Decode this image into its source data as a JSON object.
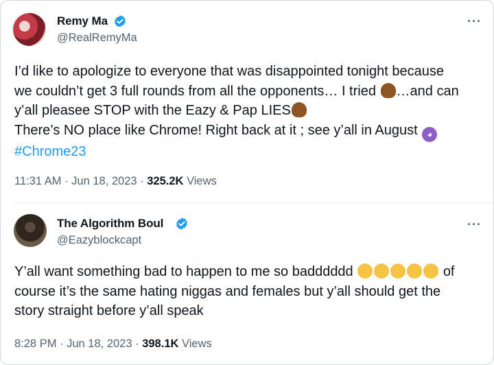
{
  "tweets": [
    {
      "author": {
        "name": "Remy Ma",
        "handle": "@RealRemyMa",
        "verified": true
      },
      "text": {
        "line1": "I’d like to apologize to everyone that was disappointed tonight because",
        "line2": "we couldn’t get 3 full rounds from all the opponents… I tried",
        "line2b": "…and can",
        "line3": "y’all pleasee STOP with the Eazy & Pap LIES",
        "line4": "There’s NO place like Chrome! Right back at it ; see y’all in August",
        "hashtag": "#Chrome23"
      },
      "timestamp": "11:31 AM · Jun 18, 2023 ·",
      "views_count": "325.2K",
      "views_label": "Views",
      "more_label": "···"
    },
    {
      "author": {
        "name": "The Algorithm Boul",
        "handle": "@Eazyblockcapt",
        "verified": true
      },
      "text": {
        "line1a": "Y’all want something bad to happen to me so badddddd",
        "line1b": "of",
        "line2": "course it’s the same hating niggas and females but y’all should get the",
        "line3": "story straight before y’all speak"
      },
      "timestamp": "8:28 PM · Jun 18, 2023 ·",
      "views_count": "398.1K",
      "views_label": "Views",
      "more_label": "···"
    }
  ],
  "colors": {
    "verified": "#1d9bf0",
    "hashtag": "#1d9bf0",
    "secondary_text": "#536471",
    "border": "#cfd9de"
  },
  "icons": [
    "verified-badge-icon",
    "more-options-icon",
    "person-facepalm-emoji",
    "person-gesturing-no-emoji",
    "smiling-face-with-horns-emoji",
    "face-with-tears-of-joy-emoji"
  ]
}
